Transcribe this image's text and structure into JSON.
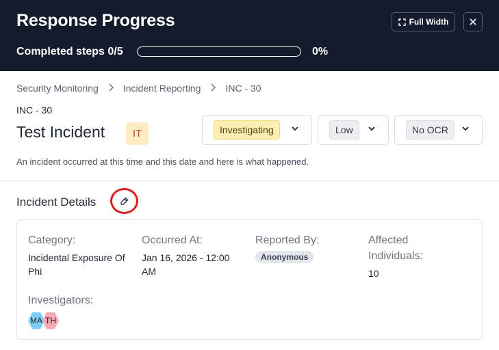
{
  "header": {
    "title": "Response Progress",
    "full_width_label": "Full Width",
    "close_icon": "close-icon",
    "progress_label": "Completed steps 0/5",
    "progress_fraction": 0,
    "progress_pct": "0%"
  },
  "breadcrumb": [
    "Security Monitoring",
    "Incident Reporting",
    "INC - 30"
  ],
  "incident": {
    "id": "INC - 30",
    "title": "Test Incident",
    "initials": "IT",
    "status": "Investigating",
    "severity": "Low",
    "ocr": "No OCR",
    "description": "An incident occurred at this time and this date and here is what happened."
  },
  "details": {
    "section_title": "Incident Details",
    "category_label": "Category:",
    "category_value": "Incidental Exposure Of Phi",
    "occurred_label": "Occurred At:",
    "occurred_value": "Jan 16, 2026 - 12:00 AM",
    "reported_label": "Reported By:",
    "reported_value": "Anonymous",
    "affected_label": "Affected Individuals:",
    "affected_value": "10",
    "investigators_label": "Investigators:",
    "investigators": [
      "MA",
      "TH"
    ]
  },
  "colors": {
    "header_bg": "#141b2c",
    "status_chip": "#fcefb2",
    "badge_it": "#fdecc4",
    "highlight_ring": "#e01b1b",
    "avatar_ma": "#80cdf5",
    "avatar_th": "#f6a9b2"
  }
}
